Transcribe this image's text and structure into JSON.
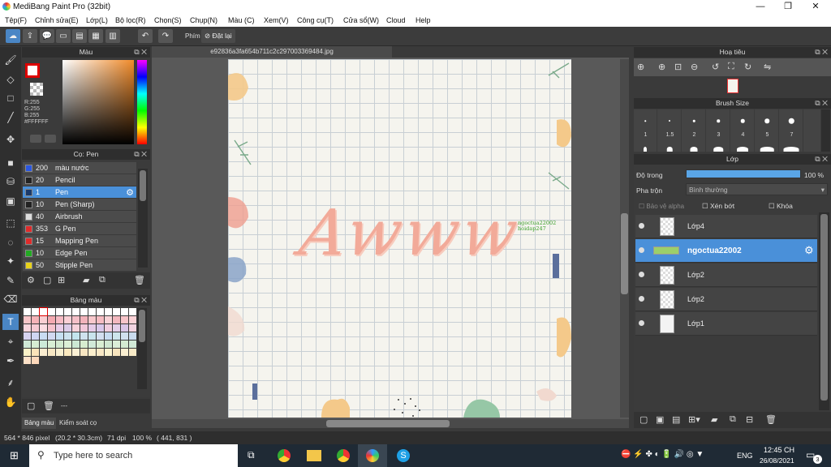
{
  "window": {
    "title": "MediBang Paint Pro (32bit)",
    "minimize": "—",
    "maximize": "❐",
    "close": "✕"
  },
  "menu": [
    "Tệp(F)",
    "Chỉnh sửa(E)",
    "Lớp(L)",
    "Bộ lọc(R)",
    "Chọn(S)",
    "Chụp(N)",
    "Màu (C)",
    "Xem(V)",
    "Công cụ(T)",
    "Cửa sổ(W)",
    "Cloud",
    "Help"
  ],
  "toolbar": {
    "label": "Phím",
    "reset": "Đặt lại"
  },
  "color_panel": {
    "title": "Màu",
    "r": "R:255",
    "g": "G:255",
    "b": "B:255",
    "hex": "#FFFFFF"
  },
  "brush_panel": {
    "title": "Cọ: Pen",
    "items": [
      {
        "size": "200",
        "name": "màu nước",
        "color": "#2b57e0"
      },
      {
        "size": "20",
        "name": "Pencil",
        "color": "#222222"
      },
      {
        "size": "1",
        "name": "Pen",
        "color": "#1a3a6a"
      },
      {
        "size": "10",
        "name": "Pen (Sharp)",
        "color": "#222222"
      },
      {
        "size": "40",
        "name": "Airbrush",
        "color": "#dddddd"
      },
      {
        "size": "353",
        "name": "G Pen",
        "color": "#e02b2b"
      },
      {
        "size": "15",
        "name": "Mapping Pen",
        "color": "#e02b2b"
      },
      {
        "size": "10",
        "name": "Edge Pen",
        "color": "#22aa22"
      },
      {
        "size": "50",
        "name": "Stipple Pen",
        "color": "#e8d21a"
      }
    ]
  },
  "palette_panel": {
    "title": "Bảng màu",
    "footer": "---"
  },
  "bottom_tabs": [
    "Bảng màu",
    "Kiểm soát cọ"
  ],
  "canvas": {
    "tab": "e92836a3fa654b711c2c297003369484.jpg",
    "lettering": "Awww",
    "credit1": "ngoctua22002",
    "credit2": "hoidap247"
  },
  "navigator": {
    "title": "Hoạ tiêu"
  },
  "brush_size": {
    "title": "Brush Size",
    "labels": [
      "1",
      "1.5",
      "2",
      "3",
      "4",
      "5",
      "7"
    ]
  },
  "layers": {
    "title": "Lớp",
    "opacity_label": "Độ trong",
    "opacity_value": "100 %",
    "blend_label": "Pha trộn",
    "blend_value": "Bình thường",
    "protect_alpha": "Bảo vệ alpha",
    "clip": "Xén bớt",
    "lock": "Khóa",
    "items": [
      "Lớp4",
      "ngoctua22002",
      "Lớp2",
      "Lớp2",
      "Lớp1"
    ]
  },
  "status": {
    "dimensions": "564 * 846 pixel",
    "size_cm": "(20.2 * 30.3cm)",
    "dpi": "71 dpi",
    "zoom": "100 %",
    "coords": "( 441, 831 )"
  },
  "taskbar": {
    "search": "Type here to search",
    "lang": "ENG",
    "time": "12:45 CH",
    "date": "26/08/2021",
    "notif": "3"
  }
}
